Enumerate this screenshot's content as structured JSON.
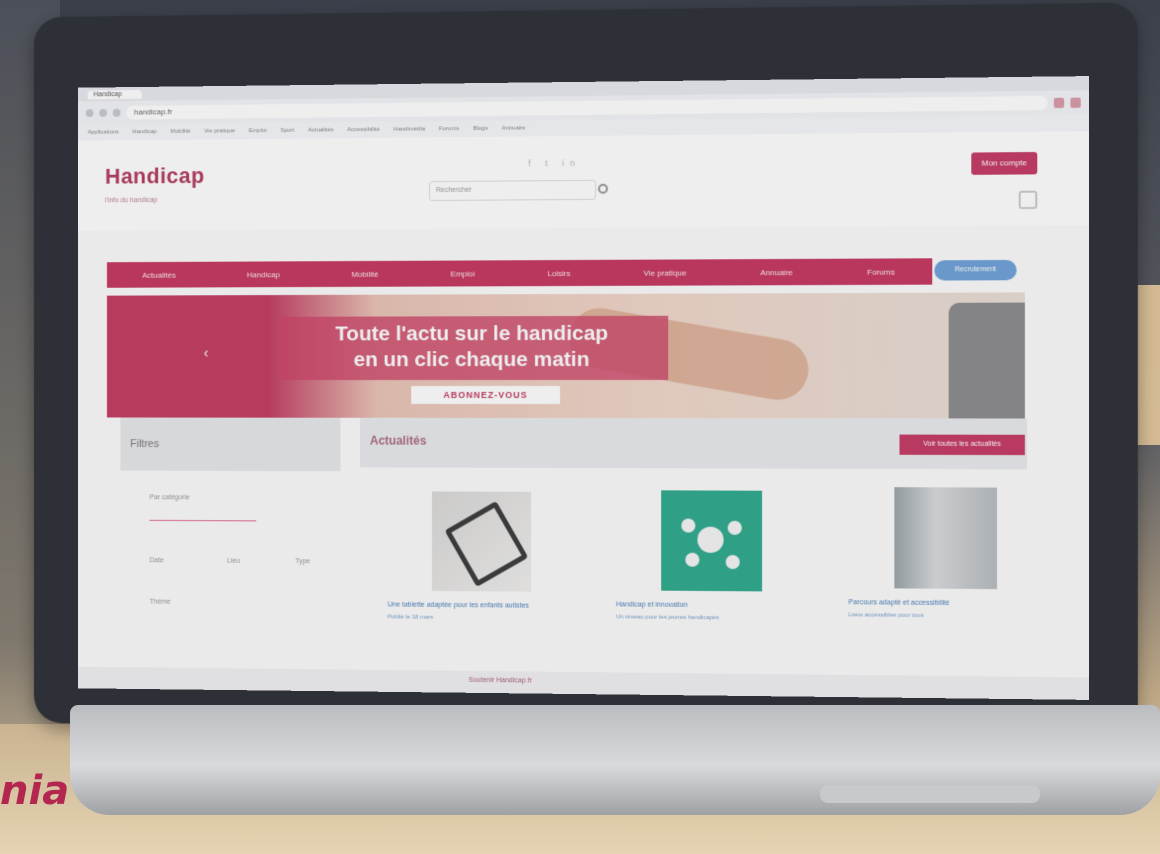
{
  "browser": {
    "tab_label": "Handicap",
    "url": "handicap.fr",
    "bookmarks": [
      "Applications",
      "Handicap",
      "Mobilité",
      "Vie pratique",
      "Emploi",
      "Sport",
      "Actualités",
      "Accessibilité",
      "Handimédia",
      "Forums",
      "Blogs",
      "Annuaire"
    ]
  },
  "site": {
    "logo_text": "Handicap",
    "logo_subtitle": "l'info du handicap",
    "search_placeholder": "Rechercher",
    "login_label": "Mon compte",
    "menu_items": [
      "Actualités",
      "Handicap",
      "Mobilité",
      "Emploi",
      "Loisirs",
      "Vie pratique",
      "Annuaire",
      "Forums"
    ],
    "menu_badge": "Recrutement"
  },
  "banner": {
    "line1": "Toute l'actu sur le handicap",
    "line2": "en un clic chaque matin",
    "cta": "ABONNEZ-VOUS"
  },
  "sidebar": {
    "title": "Filtres",
    "filters": [
      "Par catégorie",
      "Date",
      "Lieu",
      "Type",
      "Thème"
    ]
  },
  "section": {
    "title": "Actualités",
    "cta": "Voir toutes les actualités"
  },
  "cards": [
    {
      "title": "Une tablette adaptée pour les enfants autistes",
      "sub": "Publié le 18 mars"
    },
    {
      "title": "Handicap et innovation",
      "sub": "Un réseau pour les jeunes handicapés"
    },
    {
      "title": "Parcours adapté et accessibilité",
      "sub": "Lieux accessibles pour tous"
    }
  ],
  "footer_text": "Soutenir Handicap.fr",
  "corner_text": "nia",
  "colors": {
    "brand": "#c43b63",
    "link": "#4a7fb8"
  }
}
